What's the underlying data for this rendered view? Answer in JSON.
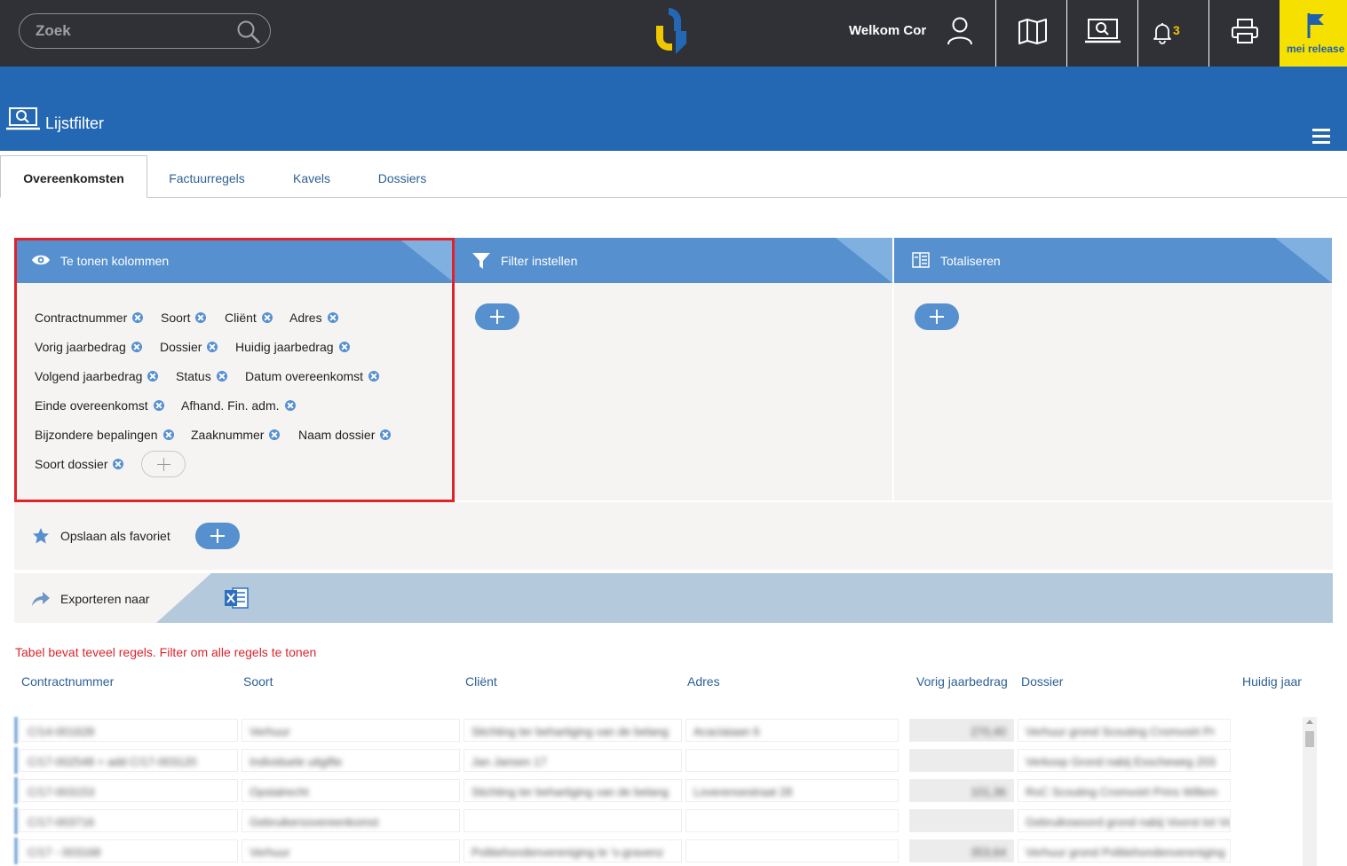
{
  "topbar": {
    "search_placeholder": "Zoek",
    "welcome": "Welkom Cor",
    "notification_count": "3",
    "release_label": "mei release"
  },
  "band": {
    "title": "Lijstfilter"
  },
  "tabs": [
    {
      "label": "Overeenkomsten",
      "active": true
    },
    {
      "label": "Factuurregels",
      "active": false
    },
    {
      "label": "Kavels",
      "active": false
    },
    {
      "label": "Dossiers",
      "active": false
    }
  ],
  "panels": {
    "columns": {
      "title": "Te tonen kolommen",
      "chips": [
        "Contractnummer",
        "Soort",
        "Cliënt",
        "Adres",
        "Vorig jaarbedrag",
        "Dossier",
        "Huidig jaarbedrag",
        "Volgend jaarbedrag",
        "Status",
        "Datum overeenkomst",
        "Einde overeenkomst",
        "Afhand. Fin. adm.",
        "Bijzondere bepalingen",
        "Zaaknummer",
        "Naam dossier",
        "Soort dossier"
      ]
    },
    "filter": {
      "title": "Filter instellen"
    },
    "totals": {
      "title": "Totaliseren"
    }
  },
  "favorite": {
    "label": "Opslaan als favoriet"
  },
  "export": {
    "label": "Exporteren naar"
  },
  "warning": "Tabel bevat teveel regels. Filter om alle regels te tonen",
  "table": {
    "headers": [
      "Contractnummer",
      "Soort",
      "Cliënt",
      "Adres",
      "Vorig jaarbedrag",
      "Dossier",
      "Huidig jaar"
    ],
    "rows": [
      [
        "C/14-001628",
        "Verhuur",
        "Stichting ter behartiging van de belang",
        "Acaciaiaan 6",
        "270,40",
        "Verhuur grond Scouting Cromvoirt Pr"
      ],
      [
        "C/17-002548 + add C/17-003120",
        "Individuele uitgifte",
        "Jan Jansen 17",
        "",
        "",
        "Verkoop Grond nabij Esscheweg 203"
      ],
      [
        "C/17-003153",
        "Opstalrecht",
        "Stichting ter behartiging van de belang",
        "Loverensestraat 28",
        "101,36",
        "RoC Scouting Cromvoirt Prins Willem"
      ],
      [
        "C/17-003716",
        "Gebruikersovereenkomst",
        "",
        "",
        "",
        "Gebruikswoord grond nabij Voorst tot Vo"
      ],
      [
        "C/17 - 003168",
        "Verhuur",
        "Politiehondenvereniging te 's-gravenz",
        "",
        "353,64",
        "Verhuur grond Politiehondenvereniging"
      ]
    ]
  },
  "colors": {
    "topbar": "#2f3137",
    "band": "#2468b3",
    "accent": "#5690cf",
    "warning": "#d9262c",
    "highlight": "#e0222a",
    "release": "#f5e000"
  }
}
